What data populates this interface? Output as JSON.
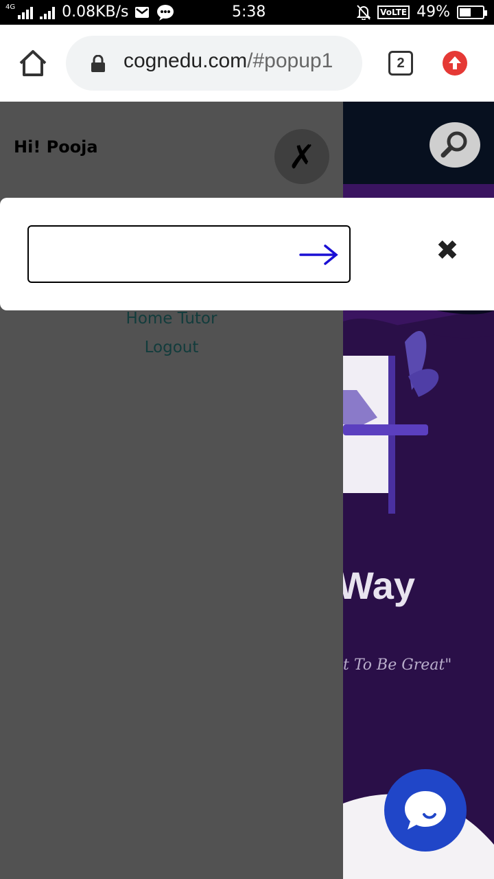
{
  "status_bar": {
    "network": "4G",
    "speed": "0.08KB/s",
    "time": "5:38",
    "volte": "VoLTE",
    "battery": "49%",
    "battery_level": 0.49
  },
  "browser": {
    "url_domain": "cognedu.com",
    "url_path": "/#popup1",
    "tab_count": "2"
  },
  "drawer": {
    "greeting": "Hi! Pooja",
    "menu_items": [
      "Home Tutor",
      "Logout"
    ]
  },
  "page": {
    "hero_fragment": "Way",
    "quote_fragment": "t To Be Great\""
  },
  "popup": {
    "search_value": "",
    "search_placeholder": ""
  },
  "colors": {
    "accent_blue": "#2046c8",
    "arrow_blue": "#1a0fd4",
    "update_red": "#e53935"
  }
}
